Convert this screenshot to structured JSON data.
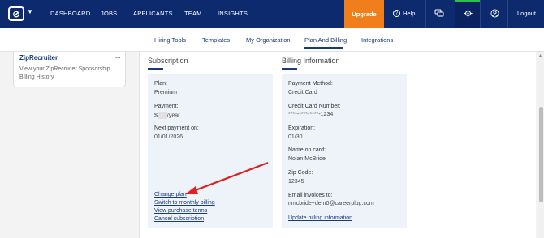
{
  "topnav": {
    "logo_glyph": "⊘",
    "items": [
      "DASHBOARD",
      "JOBS",
      "APPLICANTS",
      "TEAM",
      "INSIGHTS"
    ],
    "upgrade_label": "Upgrade",
    "help_label": "Help",
    "logout_label": "Logout",
    "accent_color": "#f07f1b",
    "brand_color": "#0d2a6e"
  },
  "subnav": {
    "items": [
      "Hiring Tools",
      "Templates",
      "My Organization",
      "Plan And Billing",
      "Integrations"
    ],
    "active": "Plan And Billing"
  },
  "left_card": {
    "title": "ZipRecruiter",
    "description": "View your ZipRecruiter Sponsorship Billing History"
  },
  "subscription": {
    "title": "Subscription",
    "plan_label": "Plan:",
    "plan_value": "Premium",
    "payment_label": "Payment:",
    "payment_prefix": "$",
    "payment_suffix": "/year",
    "next_label": "Next payment on:",
    "next_value": "01/01/2026",
    "links": [
      "Change plan",
      "Switch to monthly billing",
      "View purchase terms",
      "Cancel subscription"
    ]
  },
  "billing": {
    "title": "Billing Information",
    "method_label": "Payment Method:",
    "method_value": "Credit Card",
    "card_label": "Credit Card Number:",
    "card_value": "****-****-****-1234",
    "exp_label": "Expiration:",
    "exp_value": "01/30",
    "name_label": "Name on card:",
    "name_value": "Nolan McBride",
    "zip_label": "Zip Code:",
    "zip_value": "12345",
    "email_label": "Email invoices to:",
    "email_value": "nmcbride+dem0@careerplug.com",
    "update_link": "Update billing information"
  }
}
